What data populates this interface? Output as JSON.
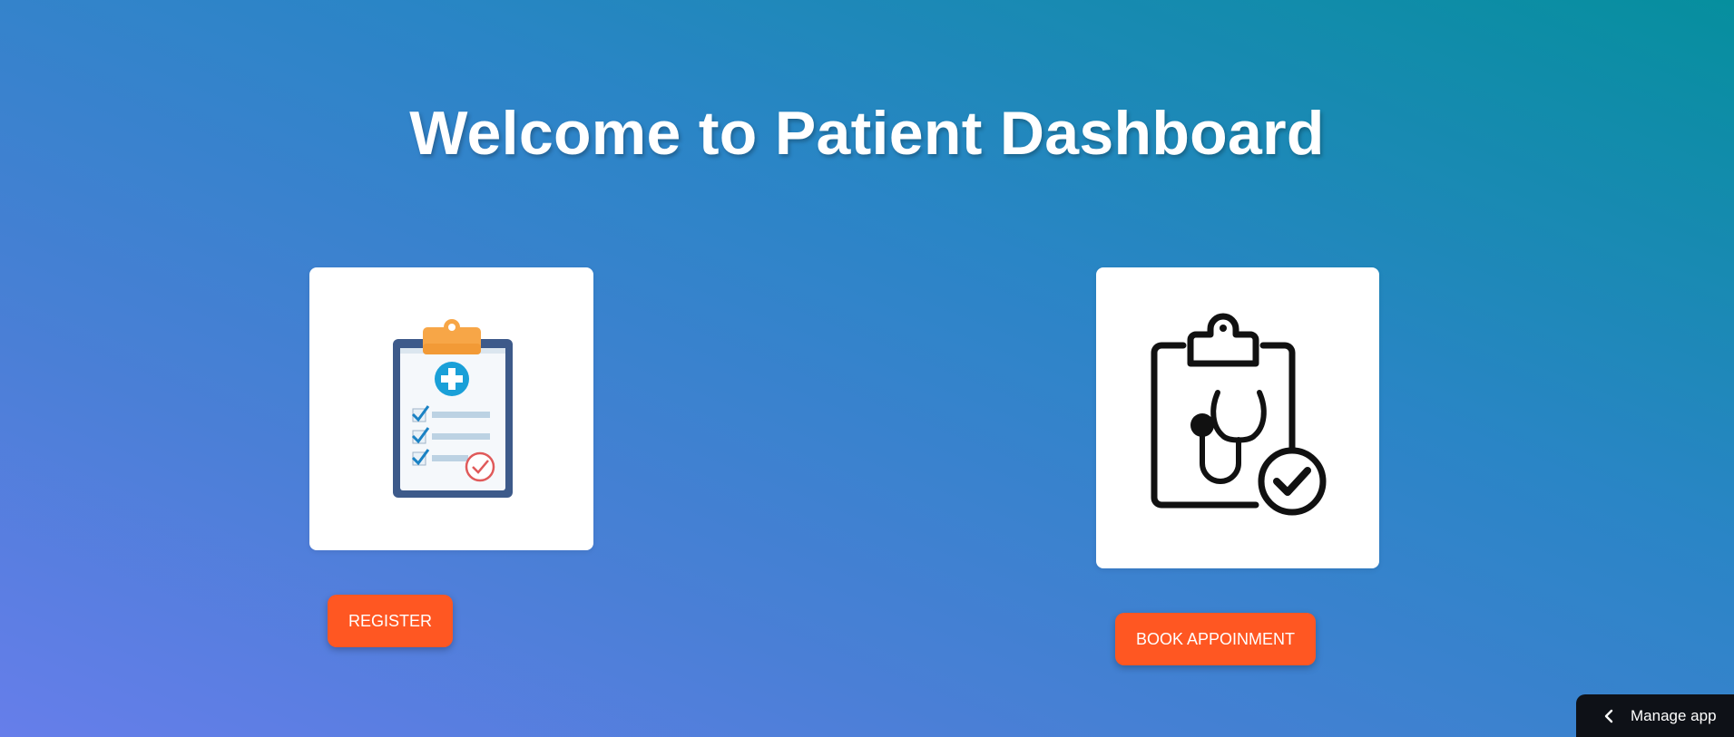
{
  "page": {
    "title": "Welcome to Patient Dashboard"
  },
  "cards": {
    "register": {
      "icon": "clipboard-medical-checklist-icon"
    },
    "book": {
      "icon": "clipboard-stethoscope-check-icon"
    }
  },
  "buttons": {
    "register_label": "REGISTER",
    "book_label": "BOOK APPOINMENT"
  },
  "footer": {
    "manage_app_label": "Manage app",
    "manage_app_icon": "chevron-left-icon"
  },
  "colors": {
    "accent": "#ff5722",
    "gradient_start": "#667eea",
    "gradient_end": "#068f9e",
    "manage_bg": "#0e1117"
  }
}
